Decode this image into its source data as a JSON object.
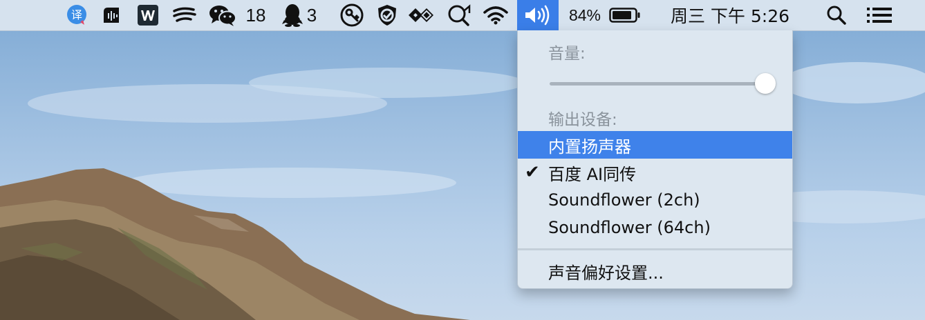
{
  "menubar": {
    "wechat_count": "18",
    "qq_count": "3",
    "battery_percent": "84%",
    "clock": "周三 下午 5:26",
    "icons": [
      "translate-icon",
      "audio-app-icon",
      "wps-icon",
      "wind-icon",
      "wechat-icon",
      "qq-icon",
      "key-icon",
      "shield-icon",
      "diamond-app-icon",
      "search-app-icon",
      "wifi-icon",
      "volume-icon",
      "battery-icon",
      "spotlight-icon",
      "control-center-icon"
    ]
  },
  "sound_menu": {
    "volume_heading": "音量:",
    "volume_level": 1.0,
    "output_heading": "输出设备:",
    "devices": [
      {
        "label": "内置扬声器",
        "highlighted": true,
        "checked": false
      },
      {
        "label": "百度 AI同传",
        "highlighted": false,
        "checked": true
      },
      {
        "label": "Soundflower (2ch)",
        "highlighted": false,
        "checked": false
      },
      {
        "label": "Soundflower (64ch)",
        "highlighted": false,
        "checked": false
      }
    ],
    "check_mark": "✔",
    "preferences_label": "声音偏好设置..."
  },
  "colors": {
    "accent": "#3f82ea",
    "menubar_bg": "#d6e2ee",
    "menu_bg": "#dde7f0"
  }
}
